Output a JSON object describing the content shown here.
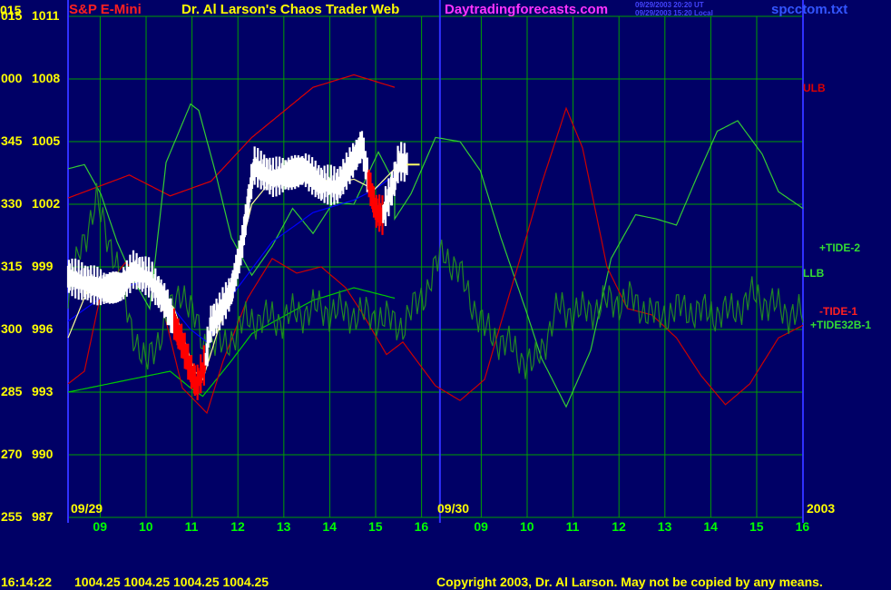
{
  "header": {
    "left_code": "015",
    "title": "S&P E-Mini",
    "center": "Dr. Al Larson's Chaos Trader Web",
    "site": "Daytradingforecasts.com",
    "stamp1": "09/29/2003 20:20 UT",
    "stamp2": "09/29/2003 15:20 Local",
    "file": "spcctom.txt"
  },
  "footer": {
    "time": "16:14:22",
    "quotes": "1004.25 1004.25 1004.25 1004.25",
    "copyright": "Copyright 2003, Dr. Al Larson. May not be copied by any means."
  },
  "markers": {
    "day1": "09/29",
    "day2": "09/30",
    "year": "2003"
  },
  "colors": {
    "background": "#000066",
    "grid": "#00a000",
    "axis": "#3030ff",
    "label_left": "#ffff00",
    "label_bottom": "#00ff00",
    "ulb": "#dd0000",
    "llb": "#00cc00",
    "tide2": "#33cc33",
    "tide1": "#cc0000",
    "tide32": "#228822",
    "price": "#ffffff",
    "price_down": "#ff0000",
    "avg_fast": "#ffff99",
    "avg_slow": "#0000ff"
  },
  "chart_data": {
    "type": "line",
    "ylim": [
      987,
      1011
    ],
    "y_ticks": [
      {
        "code": "015",
        "price": "1011"
      },
      {
        "code": "000",
        "price": "1008"
      },
      {
        "code": "345",
        "price": "1005"
      },
      {
        "code": "330",
        "price": "1002"
      },
      {
        "code": "315",
        "price": "999"
      },
      {
        "code": "300",
        "price": "996"
      },
      {
        "code": "285",
        "price": "993"
      },
      {
        "code": "270",
        "price": "990"
      },
      {
        "code": "255",
        "price": "987"
      }
    ],
    "x_ticks": [
      "09",
      "10",
      "11",
      "12",
      "13",
      "14",
      "15",
      "16",
      "09",
      "10",
      "11",
      "12",
      "13",
      "14",
      "15",
      "16"
    ],
    "legend": [
      {
        "name": "ULB",
        "color": "#dd0000"
      },
      {
        "name": "+TIDE-2",
        "color": "#33dd33"
      },
      {
        "name": "LLB",
        "color": "#33dd33"
      },
      {
        "name": "-TIDE-1",
        "color": "#ff2020"
      },
      {
        "name": "+TIDE32B-1",
        "color": "#33dd33"
      }
    ],
    "series": [
      {
        "key": "ulb",
        "points": [
          [
            0,
            1002.3
          ],
          [
            1.5,
            1003.4
          ],
          [
            2.5,
            1002.4
          ],
          [
            3.5,
            1003.1
          ],
          [
            4.5,
            1005.2
          ],
          [
            6,
            1007.6
          ],
          [
            7,
            1008.2
          ],
          [
            8,
            1007.6
          ]
        ]
      },
      {
        "key": "llb",
        "points": [
          [
            0,
            993.0
          ],
          [
            1.5,
            993.6
          ],
          [
            2.5,
            994.0
          ],
          [
            3.0,
            993.2
          ],
          [
            3.3,
            992.8
          ],
          [
            4,
            994.5
          ],
          [
            4.5,
            995.8
          ],
          [
            6,
            997.4
          ],
          [
            7,
            998.0
          ],
          [
            8,
            997.5
          ]
        ]
      },
      {
        "key": "tide2",
        "points": [
          [
            0,
            1003.7
          ],
          [
            0.4,
            1003.9
          ],
          [
            0.8,
            1002.5
          ],
          [
            1.2,
            1000.2
          ],
          [
            1.6,
            998.4
          ],
          [
            2.0,
            997.0
          ],
          [
            2.4,
            1004.0
          ],
          [
            3.0,
            1006.8
          ],
          [
            3.2,
            1006.5
          ],
          [
            3.6,
            1003.6
          ],
          [
            4.0,
            1000.4
          ],
          [
            4.5,
            998.6
          ],
          [
            5.0,
            1000.0
          ],
          [
            5.5,
            1001.8
          ],
          [
            6.0,
            1000.6
          ],
          [
            6.5,
            1002.1
          ],
          [
            7.0,
            1002.0
          ],
          [
            7.6,
            1004.5
          ],
          [
            8.0,
            1003.0
          ],
          [
            8.0,
            1001.3
          ],
          [
            8.4,
            1002.5
          ],
          [
            9.0,
            1005.2
          ],
          [
            9.6,
            1005.0
          ],
          [
            10.1,
            1003.6
          ],
          [
            10.6,
            1000.4
          ],
          [
            11.2,
            997.0
          ],
          [
            11.6,
            994.6
          ],
          [
            12.2,
            992.3
          ],
          [
            12.8,
            995.0
          ],
          [
            13.3,
            999.4
          ],
          [
            13.9,
            1001.5
          ],
          [
            14.4,
            1001.3
          ],
          [
            14.9,
            1001.0
          ],
          [
            15.4,
            1003.3
          ],
          [
            15.9,
            1005.5
          ],
          [
            16.4,
            1006.0
          ],
          [
            17.0,
            1004.4
          ],
          [
            17.4,
            1002.6
          ],
          [
            18.0,
            1001.8
          ]
        ]
      },
      {
        "key": "tide1",
        "points": [
          [
            0,
            993.4
          ],
          [
            0.4,
            994.0
          ],
          [
            0.8,
            997.7
          ],
          [
            1.4,
            999.2
          ],
          [
            2.2,
            998.0
          ],
          [
            2.8,
            993.2
          ],
          [
            3.4,
            992.0
          ],
          [
            3.8,
            994.5
          ],
          [
            4.4,
            997.5
          ],
          [
            5.0,
            999.4
          ],
          [
            5.6,
            998.7
          ],
          [
            6.2,
            999.0
          ],
          [
            6.8,
            998.0
          ],
          [
            7.2,
            996.8
          ],
          [
            7.8,
            994.8
          ],
          [
            8.2,
            995.4
          ],
          [
            9.0,
            993.3
          ],
          [
            9.6,
            992.6
          ],
          [
            10.2,
            993.6
          ],
          [
            10.6,
            996.3
          ],
          [
            11.1,
            999.6
          ],
          [
            11.6,
            1003.0
          ],
          [
            12.2,
            1006.6
          ],
          [
            12.6,
            1004.7
          ],
          [
            13.2,
            999.0
          ],
          [
            13.7,
            997.0
          ],
          [
            14.3,
            996.7
          ],
          [
            14.9,
            995.6
          ],
          [
            15.5,
            993.8
          ],
          [
            16.1,
            992.4
          ],
          [
            16.7,
            993.4
          ],
          [
            17.4,
            995.6
          ],
          [
            18.0,
            996.2
          ]
        ]
      },
      {
        "key": "tide32",
        "mode": "wavy",
        "amp": 0.7,
        "points": [
          [
            0,
            997.0
          ],
          [
            0.3,
            1000.0
          ],
          [
            0.7,
            1002.0
          ],
          [
            1.1,
            999.8
          ],
          [
            1.5,
            996.5
          ],
          [
            1.9,
            994.2
          ],
          [
            2.3,
            996.0
          ],
          [
            2.8,
            998.0
          ],
          [
            3.3,
            995.4
          ],
          [
            3.8,
            995.2
          ],
          [
            4.4,
            996.5
          ],
          [
            5.2,
            996.5
          ],
          [
            6.0,
            997.0
          ],
          [
            6.8,
            996.8
          ],
          [
            7.6,
            996.6
          ],
          [
            8.2,
            996.2
          ],
          [
            8.8,
            998.0
          ],
          [
            9.2,
            999.8
          ],
          [
            9.6,
            998.6
          ],
          [
            10.2,
            996.0
          ],
          [
            10.8,
            995.2
          ],
          [
            11.4,
            994.2
          ],
          [
            12.0,
            997.0
          ],
          [
            12.6,
            996.8
          ],
          [
            13.2,
            997.3
          ],
          [
            13.8,
            997.4
          ],
          [
            14.4,
            996.6
          ],
          [
            15.0,
            997.0
          ],
          [
            15.6,
            996.8
          ],
          [
            16.2,
            996.8
          ],
          [
            16.8,
            997.6
          ],
          [
            17.4,
            997.0
          ],
          [
            18.0,
            996.6
          ]
        ]
      },
      {
        "key": "avg_slow",
        "points": [
          [
            0,
            996.4
          ],
          [
            1,
            997.8
          ],
          [
            2,
            998.4
          ],
          [
            3,
            996.0
          ],
          [
            3.4,
            995.4
          ],
          [
            4,
            997.6
          ],
          [
            5,
            1000.2
          ],
          [
            6,
            1001.6
          ],
          [
            7,
            1002.2
          ],
          [
            7.5,
            1002.7
          ],
          [
            8,
            1003.4
          ]
        ]
      },
      {
        "key": "avg_fast",
        "points": [
          [
            0,
            995.6
          ],
          [
            0.5,
            998.0
          ],
          [
            1,
            998.3
          ],
          [
            2,
            998.4
          ],
          [
            2.6,
            997.0
          ],
          [
            3.1,
            994.0
          ],
          [
            3.3,
            993.6
          ],
          [
            3.6,
            995.5
          ],
          [
            4,
            998.0
          ],
          [
            4.5,
            1002.0
          ],
          [
            5,
            1003.2
          ],
          [
            6,
            1003.4
          ],
          [
            6.5,
            1003.0
          ],
          [
            7,
            1003.2
          ],
          [
            7.5,
            1002.7
          ],
          [
            8,
            1003.7
          ],
          [
            8.3,
            1003.9
          ]
        ]
      },
      {
        "key": "price",
        "mode": "bars",
        "amp": 0.5,
        "down": [
          [
            2.6,
            3.35
          ],
          [
            7.35,
            7.7
          ]
        ],
        "points": [
          [
            0,
            998.5
          ],
          [
            0.4,
            998.2
          ],
          [
            0.9,
            997.9
          ],
          [
            1.3,
            998.0
          ],
          [
            1.6,
            998.8
          ],
          [
            2.0,
            998.4
          ],
          [
            2.4,
            997.2
          ],
          [
            2.6,
            996.2
          ],
          [
            2.8,
            995.3
          ],
          [
            3.0,
            994.0
          ],
          [
            3.15,
            993.3
          ],
          [
            3.35,
            994.3
          ],
          [
            3.5,
            996.2
          ],
          [
            3.75,
            996.9
          ],
          [
            4.0,
            997.8
          ],
          [
            4.25,
            999.9
          ],
          [
            4.55,
            1003.8
          ],
          [
            5.0,
            1003.2
          ],
          [
            5.4,
            1003.4
          ],
          [
            5.8,
            1003.6
          ],
          [
            6.2,
            1002.9
          ],
          [
            6.6,
            1002.8
          ],
          [
            7.0,
            1004.1
          ],
          [
            7.2,
            1004.8
          ],
          [
            7.35,
            1003.1
          ],
          [
            7.55,
            1001.6
          ],
          [
            7.7,
            1001.4
          ],
          [
            7.95,
            1002.8
          ],
          [
            8.1,
            1004.0
          ],
          [
            8.3,
            1003.9
          ]
        ]
      }
    ]
  }
}
